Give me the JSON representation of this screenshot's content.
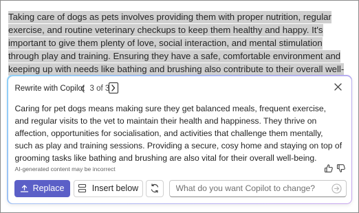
{
  "document": {
    "paragraph": "Taking care of dogs as pets involves providing them with proper nutrition, regular exercise, and routine veterinary checkups to keep them healthy and happy. It's important to give them plenty of love, social interaction, and mental stimulation through play and training. Ensuring they have a safe, comfortable environment and keeping up with needs like bathing and brushing also contribute to their overall well-being."
  },
  "copilot_panel": {
    "title": "Rewrite with Copilot",
    "counter": "3 of 3",
    "rewrite_text": "Caring for pet dogs means making sure they get balanced meals, frequent exercise, and regular visits to the vet to maintain their health and happiness. They thrive on affection, opportunities for socialisation, and activities that challenge them mentally, such as play and training sessions. Providing a secure, cosy home and staying on top of grooming tasks like bathing and brushing are also vital for their overall well-being.",
    "disclaimer": "AI-generated content may be incorrect",
    "buttons": {
      "replace": "Replace",
      "insert_below": "Insert below"
    },
    "prompt_placeholder": "What do you want Copilot to change?",
    "icons": {
      "prev": "chevron-left-icon",
      "next": "chevron-right-icon",
      "close": "close-icon",
      "thumbs_up": "thumbs-up-icon",
      "thumbs_down": "thumbs-down-icon",
      "replace": "replace-arrow-icon",
      "insert_below": "insert-below-icon",
      "regenerate": "regenerate-icon",
      "send": "send-arrow-icon"
    }
  },
  "colors": {
    "accent": "#5b5fc7",
    "highlight": "#cfcfcf",
    "panel_border_start": "#8fd0f7",
    "panel_border_end": "#c5a3ee"
  }
}
